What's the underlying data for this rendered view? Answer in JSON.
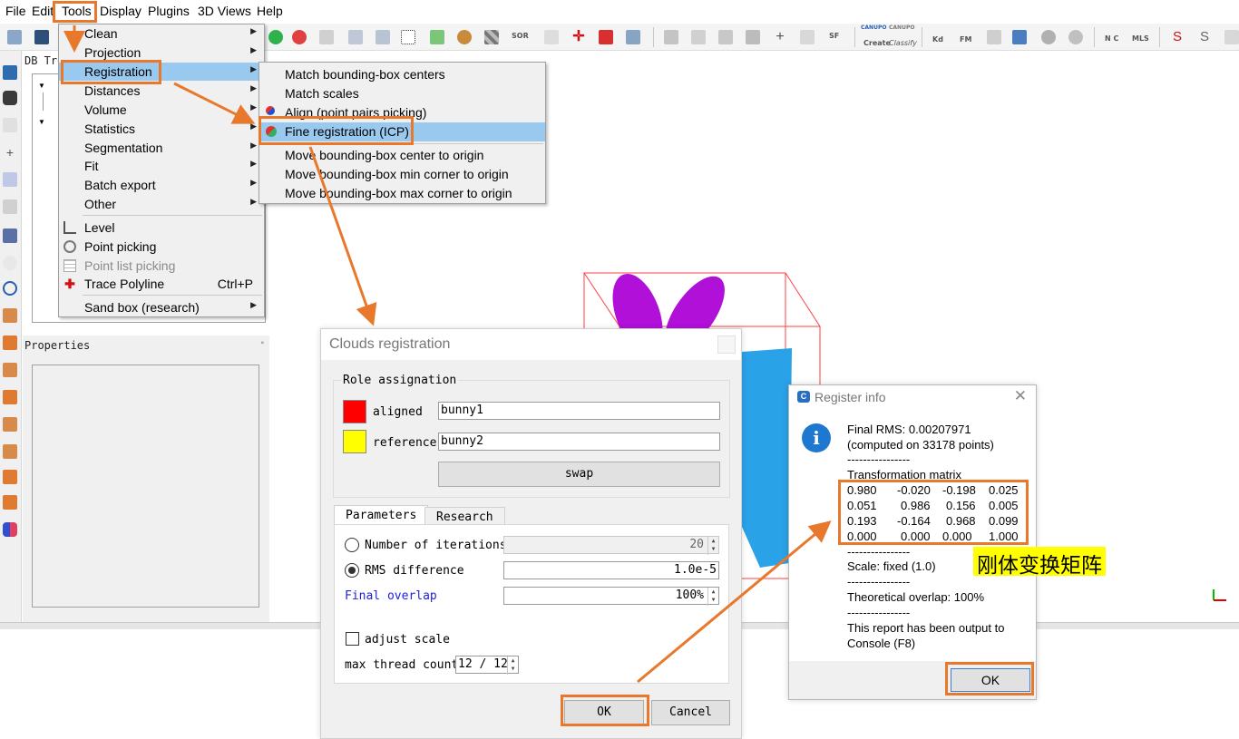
{
  "menubar": {
    "items": [
      "File",
      "Edit",
      "Tools",
      "Display",
      "Plugins",
      "3D Views",
      "Help"
    ]
  },
  "toolbar": {
    "sor_label": "SOR",
    "sf_label": "SF",
    "canupo_create_top": "CANUPO",
    "canupo_create": "Create",
    "canupo_classify_top": "CANUPO",
    "canupo_classify": "Classify",
    "kd_label": "Kd",
    "fm_label": "FM",
    "nc_label": "N C",
    "mls_label": "MLS"
  },
  "left_panel": {
    "db_tree_title": "DB Tre",
    "properties_title": "Properties",
    "pin_glyph": "◦"
  },
  "tools_menu": {
    "items": [
      {
        "label": "Clean",
        "submenu": true
      },
      {
        "label": "Projection",
        "submenu": true
      },
      {
        "label": "Registration",
        "submenu": true,
        "selected": true
      },
      {
        "label": "Distances",
        "submenu": true
      },
      {
        "label": "Volume",
        "submenu": true
      },
      {
        "label": "Statistics",
        "submenu": true
      },
      {
        "label": "Segmentation",
        "submenu": true
      },
      {
        "label": "Fit",
        "submenu": true
      },
      {
        "label": "Batch export",
        "submenu": true
      },
      {
        "label": "Other",
        "submenu": true
      }
    ],
    "items2": [
      {
        "label": "Level",
        "icon": "level-icon"
      },
      {
        "label": "Point picking",
        "icon": "point-picking-icon"
      },
      {
        "label": "Point list picking",
        "icon": "point-list-icon",
        "disabled": true
      },
      {
        "label": "Trace Polyline",
        "icon": "polyline-icon",
        "shortcut": "Ctrl+P"
      }
    ],
    "sandbox": {
      "label": "Sand box (research)",
      "submenu": true
    }
  },
  "registration_menu": {
    "items": [
      {
        "label": "Match bounding-box centers"
      },
      {
        "label": "Match scales"
      },
      {
        "label": "Align (point pairs picking)"
      },
      {
        "label": "Fine registration (ICP)",
        "selected": true
      },
      {
        "label": "Move bounding-box center to origin"
      },
      {
        "label": "Move bounding-box min corner to origin"
      },
      {
        "label": "Move bounding-box max corner to origin"
      }
    ]
  },
  "clouds_registration": {
    "title": "Clouds registration",
    "role_group": "Role assignation",
    "aligned_label": "aligned",
    "aligned_value": "bunny1",
    "aligned_color": "#ff0000",
    "reference_label": "reference",
    "reference_value": "bunny2",
    "reference_color": "#ffff00",
    "swap_label": "swap",
    "tabs": [
      "Parameters",
      "Research"
    ],
    "iterations_label": "Number of iterations",
    "iterations_value": "20",
    "rms_label": "RMS difference",
    "rms_value": "1.0e-5",
    "overlap_label": "Final overlap",
    "overlap_value": "100%",
    "adjust_scale_label": "adjust scale",
    "thread_label": "max thread count",
    "thread_value": "12 / 12",
    "ok_label": "OK",
    "cancel_label": "Cancel"
  },
  "register_info": {
    "title": "Register info",
    "rms_line": "Final RMS: 0.00207971",
    "points_line": "(computed on 33178 points)",
    "sep": "----------------",
    "matrix_title": "Transformation matrix",
    "matrix": [
      [
        "0.980",
        "-0.020",
        "-0.198",
        "0.025"
      ],
      [
        "0.051",
        "0.986",
        "0.156",
        "0.005"
      ],
      [
        "0.193",
        "-0.164",
        "0.968",
        "0.099"
      ],
      [
        "0.000",
        "0.000",
        "0.000",
        "1.000"
      ]
    ],
    "scale_line": "Scale: fixed (1.0)",
    "overlap_line": "Theoretical overlap: 100%",
    "report_line1": "This report has been output to",
    "report_line2": "Console (F8)",
    "ok_label": "OK"
  },
  "annotation": {
    "label": "刚体变换矩阵",
    "highlight_color": "#e8792c"
  }
}
